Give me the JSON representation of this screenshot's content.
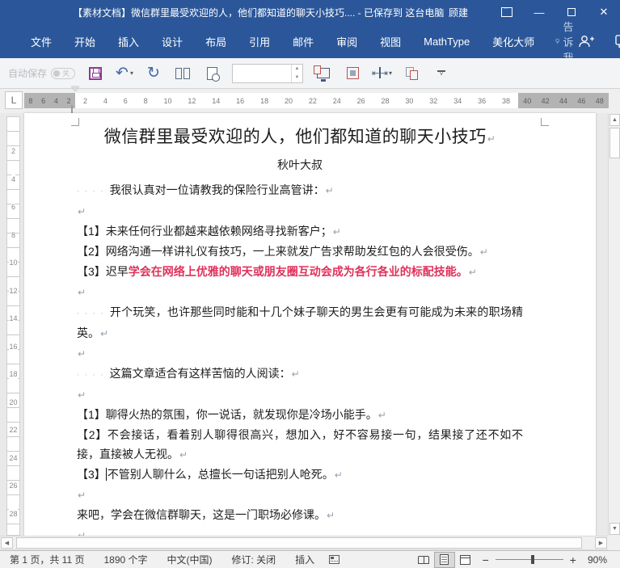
{
  "colors": {
    "titlebar": "#2b579a",
    "red_text": "#e0315b"
  },
  "titlebar": {
    "title": "【素材文档】微信群里最受欢迎的人，他们都知道的聊天小技巧.... - 已保存到 这台电脑",
    "user": "顾建",
    "minimize": "—",
    "close": "✕"
  },
  "tabbar": {
    "tabs": [
      "文件",
      "开始",
      "插入",
      "设计",
      "布局",
      "引用",
      "邮件",
      "审阅",
      "视图",
      "MathType",
      "美化大师"
    ],
    "tell_me": "告诉我",
    "bulb": "💡"
  },
  "qat": {
    "autosave_label": "自动保存",
    "autosave_state": "关",
    "spinner_value": ""
  },
  "ruler": {
    "tab_selector": "L",
    "left_numbers": [
      "8",
      "6",
      "4",
      "2"
    ],
    "center_numbers": [
      "2",
      "4",
      "6",
      "8",
      "10",
      "12",
      "14",
      "16",
      "18",
      "20",
      "22",
      "24",
      "26",
      "28",
      "30",
      "32",
      "34",
      "36",
      "38"
    ],
    "right_numbers": [
      "40",
      "42",
      "44",
      "46",
      "48"
    ],
    "vertical_numbers": [
      "2",
      "4",
      "6",
      "8",
      "10",
      "12",
      "14",
      "16",
      "18",
      "20",
      "22",
      "24",
      "26",
      "28"
    ]
  },
  "marks": {
    "pilcrow": "↵",
    "dots": "····"
  },
  "document": {
    "paragraphs": [
      {
        "kind": "title",
        "runs": [
          {
            "text": "微信群里最受欢迎的人，他们都知道的聊天小技巧"
          }
        ]
      },
      {
        "kind": "author",
        "runs": [
          {
            "text": "秋叶大叔"
          }
        ],
        "no_mark": true
      },
      {
        "kind": "body",
        "dots": true,
        "runs": [
          {
            "text": "我很认真对一位请教我的保险行业高管讲："
          }
        ]
      },
      {
        "kind": "empty",
        "runs": []
      },
      {
        "kind": "body",
        "runs": [
          {
            "text": "【1】未来任何行业都越来越依赖网络寻找新客户；"
          }
        ]
      },
      {
        "kind": "body",
        "runs": [
          {
            "text": "【2】网络沟通一样讲礼仪有技巧，一上来就发广告求帮助发红包的人会很受伤。"
          }
        ]
      },
      {
        "kind": "body",
        "runs": [
          {
            "text": "【3】迟早"
          },
          {
            "text": "学会在网络上优雅的聊天或朋友圈互动会成为各行各业的标配技能。",
            "red": true
          }
        ]
      },
      {
        "kind": "empty",
        "runs": []
      },
      {
        "kind": "body",
        "dots": true,
        "runs": [
          {
            "text": "开个玩笑，也许那些同时能和十几个妹子聊天的男生会更有可能成为未来的职场精英。"
          }
        ]
      },
      {
        "kind": "empty",
        "runs": []
      },
      {
        "kind": "body",
        "dots": true,
        "runs": [
          {
            "text": "这篇文章适合有这样苦恼的人阅读："
          }
        ]
      },
      {
        "kind": "empty",
        "runs": []
      },
      {
        "kind": "body",
        "runs": [
          {
            "text": "【1】聊得火热的氛围，你一说话，就发现你是冷场小能手。"
          }
        ]
      },
      {
        "kind": "body",
        "runs": [
          {
            "text": "【2】不会接话，看着别人聊得很高兴，想加入，好不容易接一句，结果接了还不如不接，直接被人无视。"
          }
        ]
      },
      {
        "kind": "body",
        "caret_before_run": 1,
        "runs": [
          {
            "text": "【3】"
          },
          {
            "text": "不管别人聊什么，总擅长一句话把别人呛死。"
          }
        ]
      },
      {
        "kind": "empty",
        "runs": []
      },
      {
        "kind": "body",
        "runs": [
          {
            "text": "来吧，学会在微信群聊天，这是一门职场必修课。"
          }
        ]
      },
      {
        "kind": "empty",
        "runs": []
      },
      {
        "kind": "empty",
        "runs": []
      }
    ]
  },
  "statusbar": {
    "page": "第 1 页，共 11 页",
    "word_count": "1890 个字",
    "language": "中文(中国)",
    "track_changes": "修订: 关闭",
    "insert_mode": "插入",
    "zoom_minus": "−",
    "zoom_plus": "+",
    "zoom_level": "90%"
  }
}
